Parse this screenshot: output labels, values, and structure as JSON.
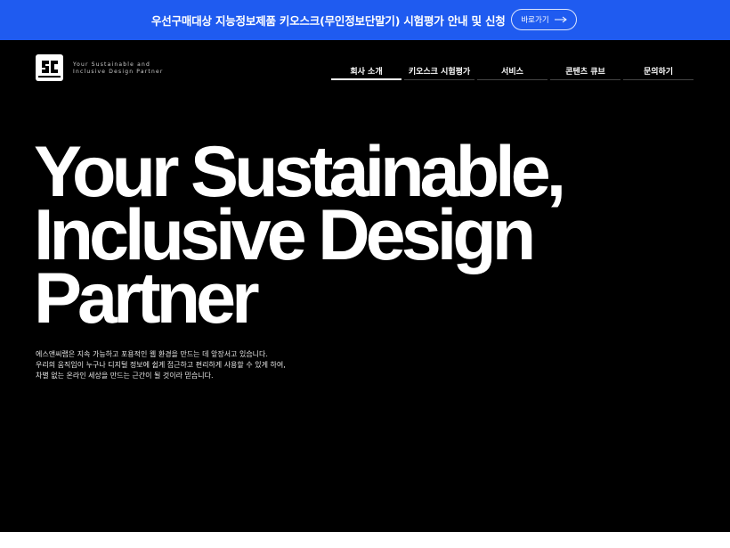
{
  "banner": {
    "text": "우선구매대상 지능정보제품 키오스크(무인정보단말기) 시험평가 안내 및 신청",
    "button_label": "바로가기",
    "background": "#1f5bf0"
  },
  "header": {
    "logo_tagline_line1": "Your Sustainable and",
    "logo_tagline_line2": "Inclusive Design Partner",
    "nav": [
      {
        "label": "회사 소개"
      },
      {
        "label": "키오스크 시험평가"
      },
      {
        "label": "서비스"
      },
      {
        "label": "콘텐츠 큐브"
      },
      {
        "label": "문의하기"
      }
    ]
  },
  "hero": {
    "line1": "Your Sustainable,",
    "line2": "Inclusive Design",
    "line3": "Partner"
  },
  "description": {
    "line1": "에스앤씨랩은 지속 가능하고 포용적인 웹 환경을 만드는 데 앞장서고 있습니다.",
    "line2": "우리의 움직임이 누구나 디지털 정보에 쉽게 접근하고 편리하게 사용할 수 있게 하여,",
    "line3": "차별 없는 온라인 세상을 만드는 근간이 될 것이라 믿습니다."
  }
}
